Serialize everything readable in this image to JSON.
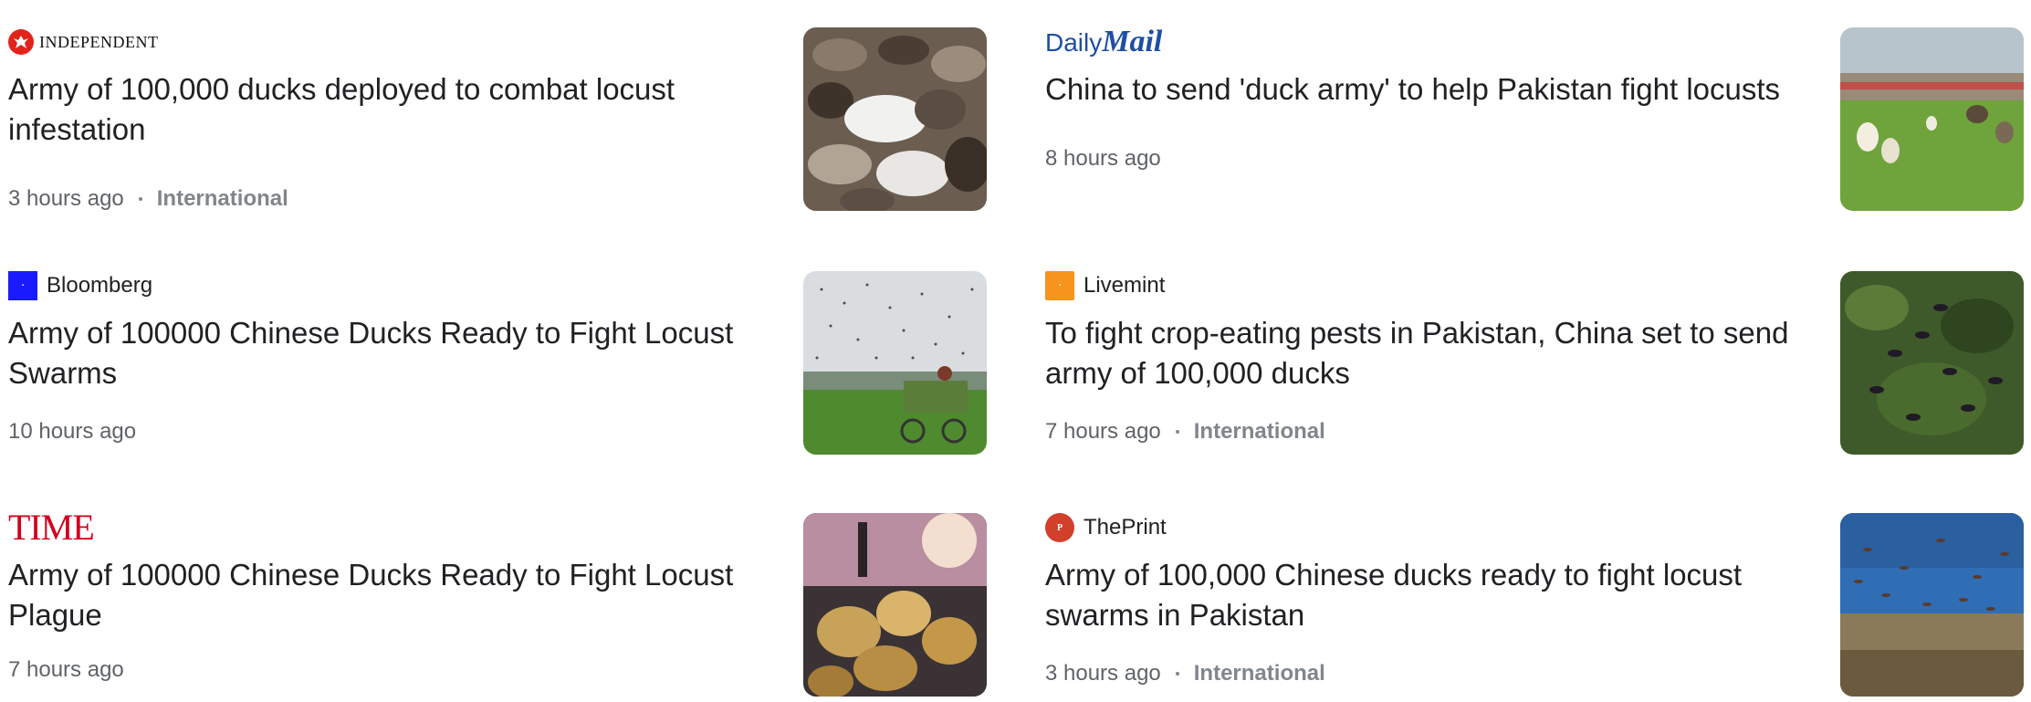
{
  "articles": [
    {
      "source": "INDEPENDENT",
      "headline": "Army of 100,000 ducks deployed to combat locust infestation",
      "time": "3 hours ago",
      "section": "International",
      "image": "ducks-flock-photo"
    },
    {
      "source_logo_text_1": "Daily",
      "source_logo_text_2": "Mail",
      "headline": "China to send 'duck army' to help Pakistan fight locusts",
      "time": "8 hours ago",
      "image": "ducks-in-field-photo"
    },
    {
      "source": "Bloomberg",
      "headline": "Army of 100000 Chinese Ducks Ready to Fight Locust Swarms",
      "time": "10 hours ago",
      "image": "locust-swarm-cart-photo"
    },
    {
      "source": "Livemint",
      "headline": "To fight crop-eating pests in Pakistan, China set to send army of 100,000 ducks",
      "time": "7 hours ago",
      "section": "International",
      "image": "locusts-on-plants-photo"
    },
    {
      "source": "TIME",
      "headline": "Army of 100000 Chinese Ducks Ready to Fight Locust Plague",
      "time": "7 hours ago",
      "image": "ducklings-closeup-photo"
    },
    {
      "source": "ThePrint",
      "headline": "Army of 100,000 Chinese ducks ready to fight locust swarms in Pakistan",
      "time": "3 hours ago",
      "section": "International",
      "image": "locusts-over-field-photo"
    }
  ],
  "colors": {
    "headline": "#202124",
    "meta": "#5f6368",
    "section": "#80868b",
    "independent_red": "#e2231a",
    "dailymail_blue": "#1f4fa3",
    "time_red": "#d0021b"
  }
}
